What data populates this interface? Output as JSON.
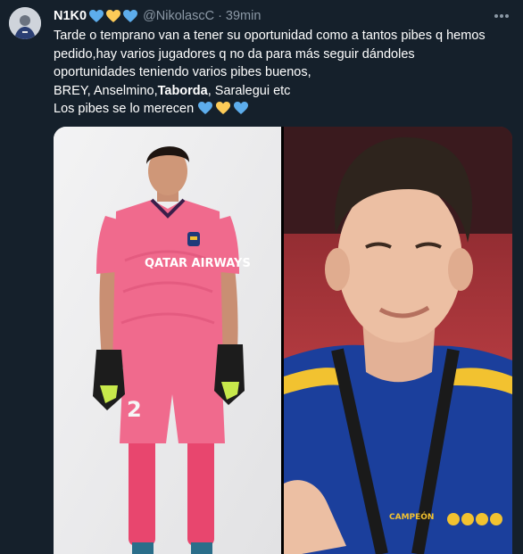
{
  "tweet": {
    "display_name": "N1K0",
    "handle": "@NikolascC",
    "separator": "·",
    "time": "39min",
    "name_hearts": [
      "blue-heart-icon",
      "yellow-heart-icon",
      "blue-heart-icon"
    ],
    "text_lines": [
      "Tarde o temprano van a tener su oportunidad como a tantos pibes q hemos",
      "pedido,hay varios jugadores q no da para más seguir dándoles",
      "oportunidades teniendo varios pibes buenos,"
    ],
    "names_line": {
      "prefix": "BREY, Anselmino,",
      "bold": "Taborda",
      "suffix": ", Saralegui etc"
    },
    "closing_line": "Los pibes se lo merecen",
    "closing_hearts": [
      "blue-heart-icon",
      "yellow-heart-icon",
      "blue-heart-icon"
    ],
    "more_icon": "more-horizontal-icon"
  },
  "colors": {
    "background": "#15202b",
    "text": "#ffffff",
    "muted": "#8b98a5",
    "heart_blue": "#5dadec",
    "heart_yellow": "#fdcb58"
  },
  "media": {
    "left_photo_text": "QATAR AIRWAYS",
    "left_photo_number": "2",
    "right_photo_text": "CAMPEÓN"
  }
}
